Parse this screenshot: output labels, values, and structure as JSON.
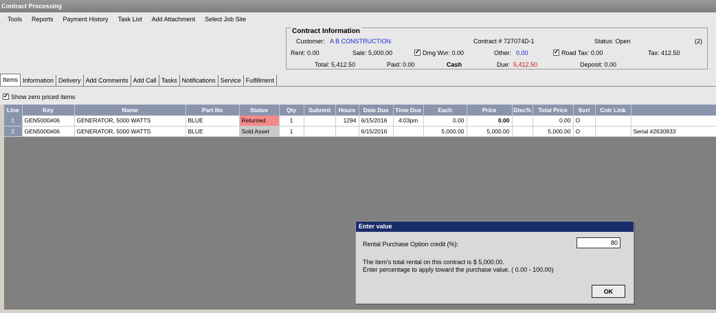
{
  "window": {
    "title": "Contract Processing"
  },
  "menu": [
    "Tools",
    "Reports",
    "Payment History",
    "Task List",
    "Add Attachment",
    "Select Job Site"
  ],
  "contract": {
    "legend": "Contract Information",
    "customer_label": "Customer:",
    "customer_value": "A  B  CONSTRUCTION",
    "contract_no": "Contract # 727074D-1",
    "status": "Status:  Open",
    "count": "(2)",
    "rent": "Rent: 0.00",
    "sale": "Sale: 5,000.00",
    "dmg_wvr": "Dmg Wvr: 0.00",
    "other_label": "Other:",
    "other_value": "0.00",
    "road_tax": "Road Tax:  0.00",
    "tax": "Tax: 412.50",
    "total": "Total: 5,412.50",
    "paid": "Paid: 0.00",
    "cash": "Cash",
    "due_label": "Due:",
    "due_value": "5,412.50",
    "deposit": "Deposit: 0.00"
  },
  "tabs": [
    "Items",
    "Information",
    "Delivery",
    "Add Comments",
    "Add Call",
    "Tasks",
    "Notifications",
    "Service",
    "Fulfillment"
  ],
  "show_zero_label": "Show zero priced items",
  "grid": {
    "headers": [
      "Line",
      "Key",
      "Name",
      "Part No",
      "Status",
      "Qty",
      "Subrent",
      "Hours",
      "Date Due",
      "Time Due",
      "Each",
      "Price",
      "Disc%",
      "Total Price",
      "Sort",
      "Cntr Link",
      ""
    ],
    "rows": [
      [
        "1",
        "GEN5000#06",
        "GENERATOR, 5000 WATTS",
        "BLUE",
        "Returned",
        "1",
        "",
        "1294",
        "6/15/2016",
        "4:03pm",
        "0.00",
        "0.00",
        "",
        "0.00",
        "O",
        "",
        ""
      ],
      [
        "2",
        "GEN5000#06",
        "GENERATOR, 5000 WATTS",
        "BLUE",
        "Sold Asset",
        "1",
        "",
        "",
        "6/15/2016",
        "",
        "5,000.00",
        "5,000.00",
        "",
        "5,000.00",
        "O",
        "",
        "Serial #2630833"
      ]
    ]
  },
  "dialog": {
    "title": "Enter value",
    "label": "Rental Purchase Option credit (%):",
    "value": "80",
    "msg1": "The item's total rental on this contract is $ 5,000.00.",
    "msg2": "Enter percentage to apply toward the purchase value. ( 0.00 - 100.00)",
    "ok": "OK"
  },
  "colors": {
    "grid_header": "#8a95ad",
    "returned": "#f28a8a",
    "dialog_title": "#1a2d6b",
    "link_blue": "#1a2ecb",
    "due_red": "#d01010"
  }
}
